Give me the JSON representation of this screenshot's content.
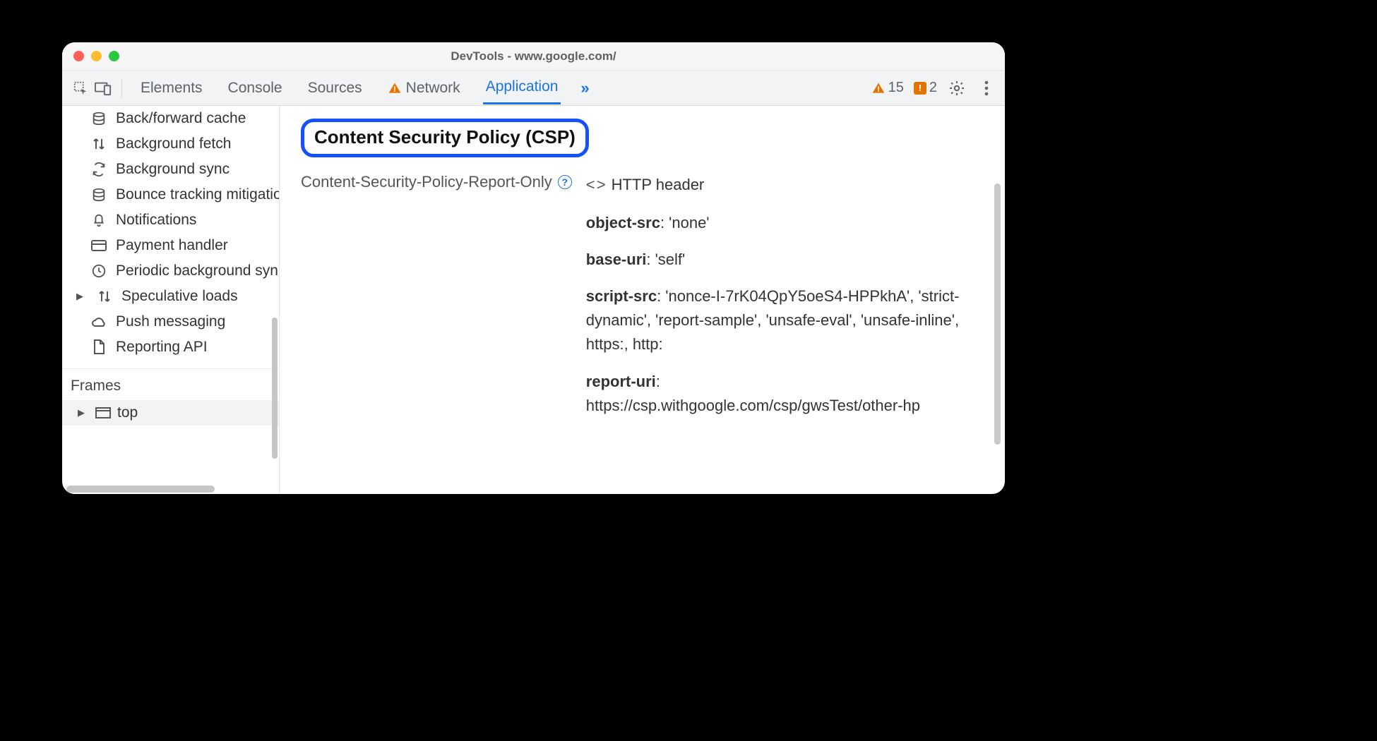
{
  "window": {
    "title": "DevTools - www.google.com/"
  },
  "toolbar": {
    "tabs": [
      "Elements",
      "Console",
      "Sources",
      "Network",
      "Application"
    ],
    "more": "»",
    "warning_count": "15",
    "issues_count": "2"
  },
  "sidebar": {
    "items": [
      {
        "icon": "database",
        "label": "Back/forward cache"
      },
      {
        "icon": "updown",
        "label": "Background fetch"
      },
      {
        "icon": "sync",
        "label": "Background sync"
      },
      {
        "icon": "database",
        "label": "Bounce tracking mitigations"
      },
      {
        "icon": "bell",
        "label": "Notifications"
      },
      {
        "icon": "card",
        "label": "Payment handler"
      },
      {
        "icon": "clock",
        "label": "Periodic background sync"
      },
      {
        "icon": "updown",
        "label": "Speculative loads",
        "expandable": true
      },
      {
        "icon": "cloud",
        "label": "Push messaging"
      },
      {
        "icon": "file",
        "label": "Reporting API"
      }
    ],
    "frames_label": "Frames",
    "frames": [
      {
        "label": "top"
      }
    ]
  },
  "csp": {
    "heading": "Content Security Policy (CSP)",
    "header_name": "Content-Security-Policy-Report-Only",
    "source_label": "HTTP header",
    "directives": [
      {
        "name": "object-src",
        "value": ": 'none'"
      },
      {
        "name": "base-uri",
        "value": ": 'self'"
      },
      {
        "name": "script-src",
        "value": ": 'nonce-I-7rK04QpY5oeS4-HPPkhA', 'strict-dynamic', 'report-sample', 'unsafe-eval', 'unsafe-inline', https:, http:"
      },
      {
        "name": "report-uri",
        "value": ": https://csp.withgoogle.com/csp/gwsTest/other-hp"
      }
    ]
  }
}
